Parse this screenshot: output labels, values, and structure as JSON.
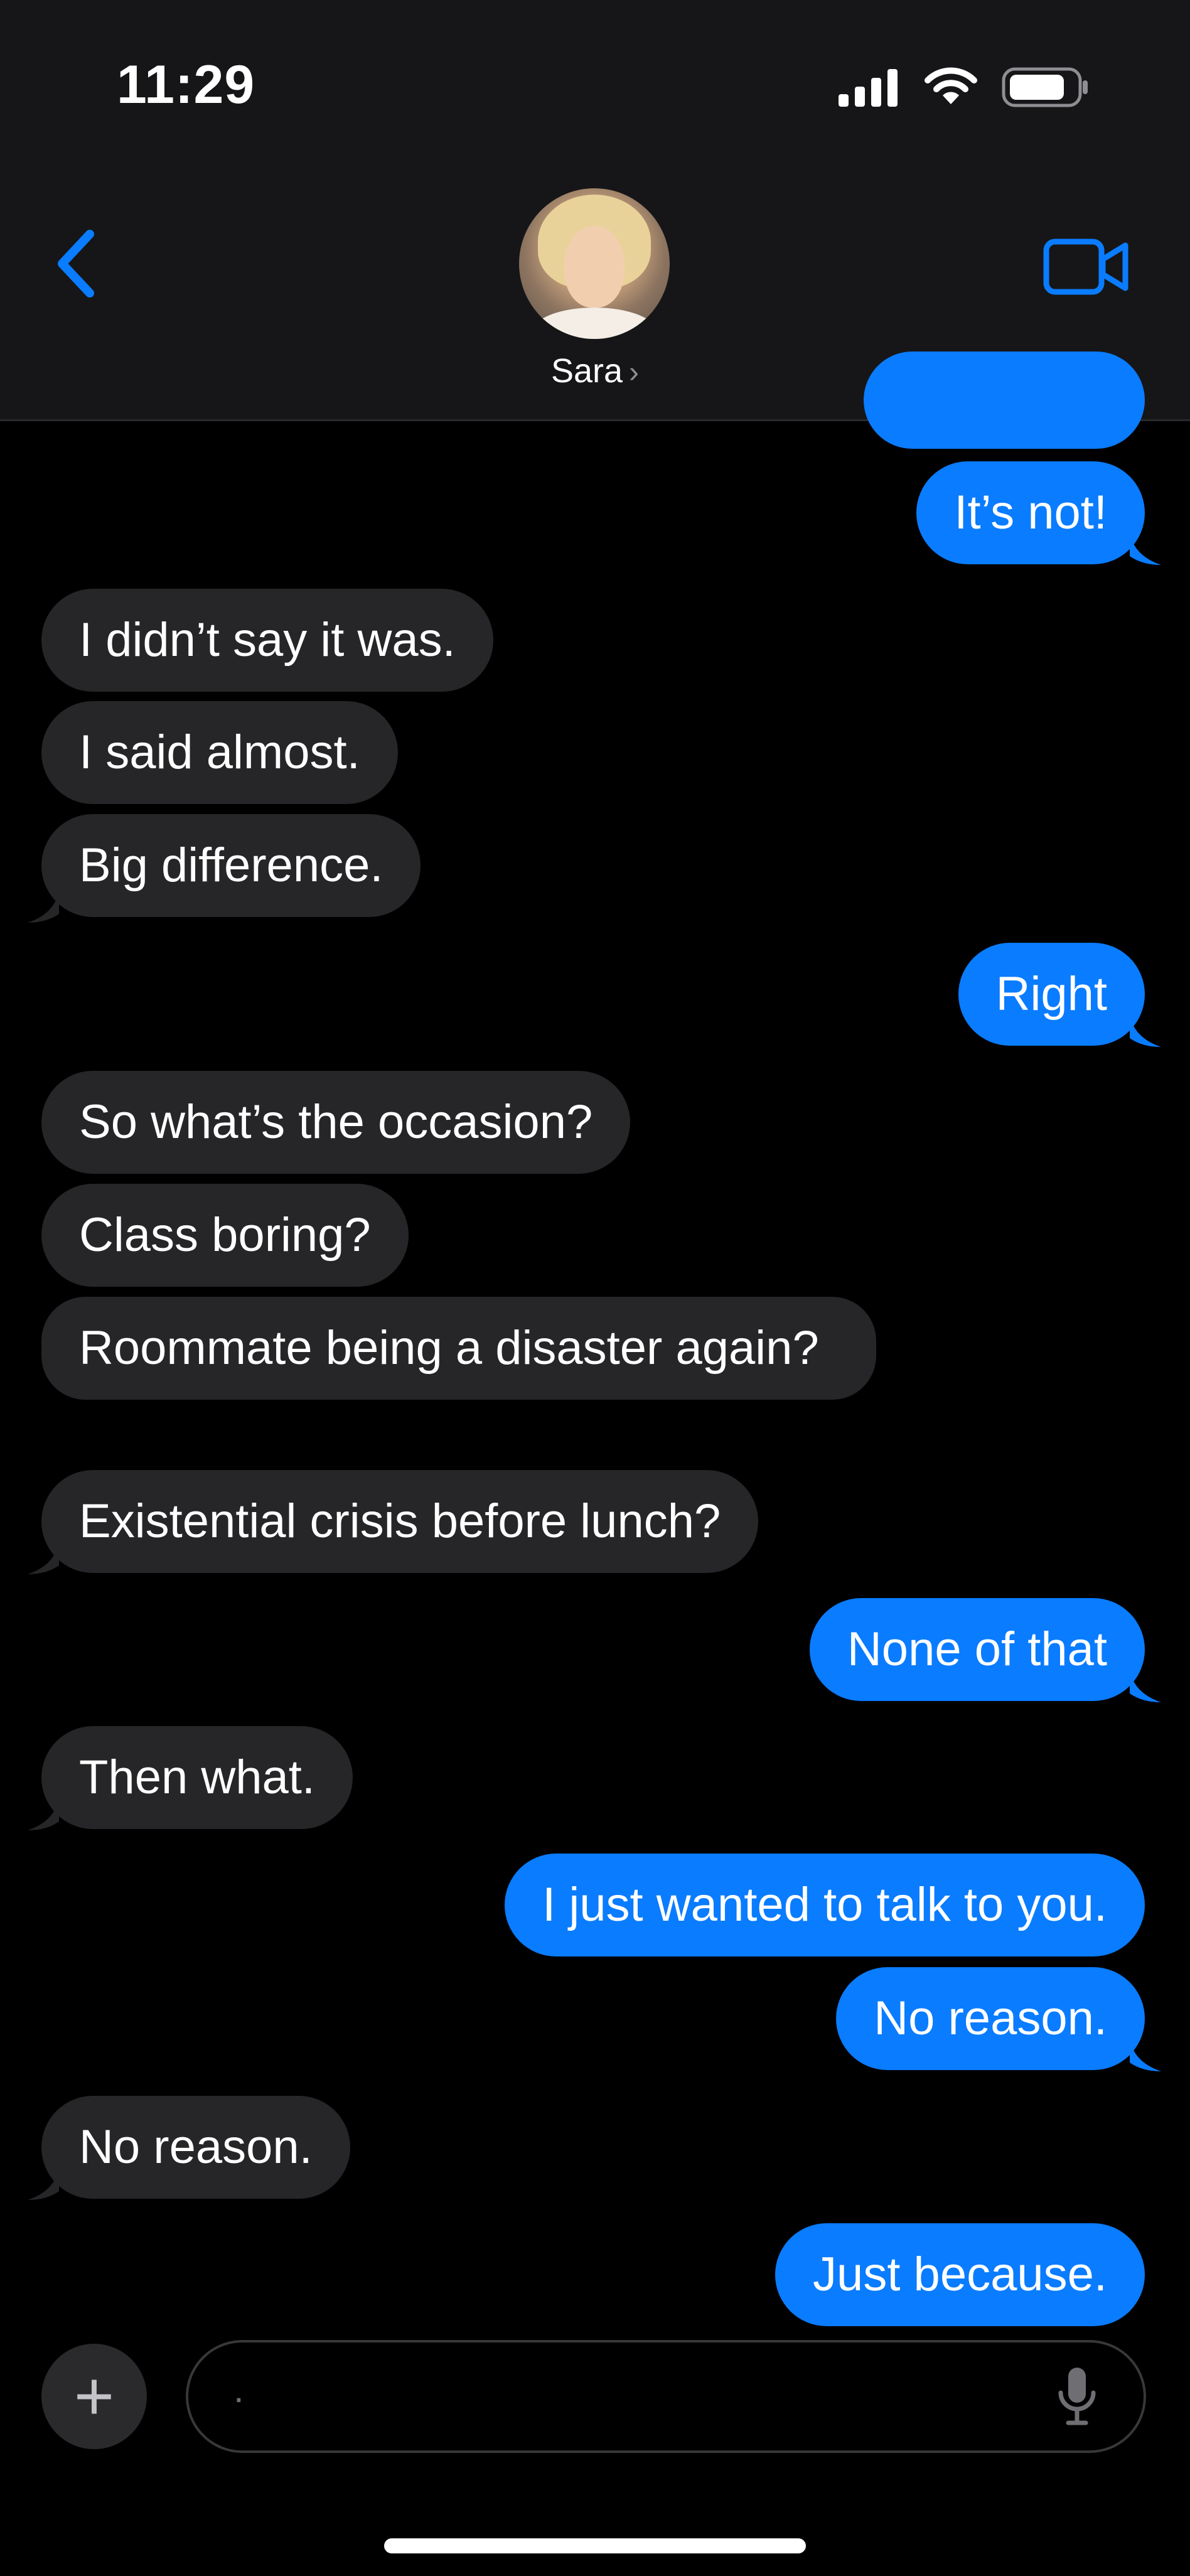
{
  "status_bar": {
    "time": "11:29"
  },
  "header": {
    "contact_name": "Sara"
  },
  "messages": [
    {
      "from": "me",
      "text": "It’s not!"
    },
    {
      "from": "them",
      "text": "I didn’t say it was."
    },
    {
      "from": "them",
      "text": "I said almost."
    },
    {
      "from": "them",
      "text": "Big difference."
    },
    {
      "from": "me",
      "text": "Right"
    },
    {
      "from": "them",
      "text": "So what’s the occasion?"
    },
    {
      "from": "them",
      "text": "Class boring?"
    },
    {
      "from": "them",
      "text": "Roommate being a disaster again?"
    },
    {
      "from": "them",
      "text": "Existential crisis before lunch?"
    },
    {
      "from": "me",
      "text": "None of that"
    },
    {
      "from": "them",
      "text": "Then what."
    },
    {
      "from": "me",
      "text": "I just wanted to talk to you."
    },
    {
      "from": "me",
      "text": "No reason."
    },
    {
      "from": "them",
      "text": "No reason."
    },
    {
      "from": "me",
      "text": "Just because."
    }
  ],
  "composer": {
    "placeholder": "."
  },
  "colors": {
    "accent": "#0a7cff",
    "incoming_bubble": "#262628",
    "header_bg": "#161618"
  },
  "icons": [
    "back-chevron-icon",
    "video-camera-icon",
    "plus-icon",
    "microphone-icon",
    "signal-icon",
    "wifi-icon",
    "battery-icon"
  ]
}
